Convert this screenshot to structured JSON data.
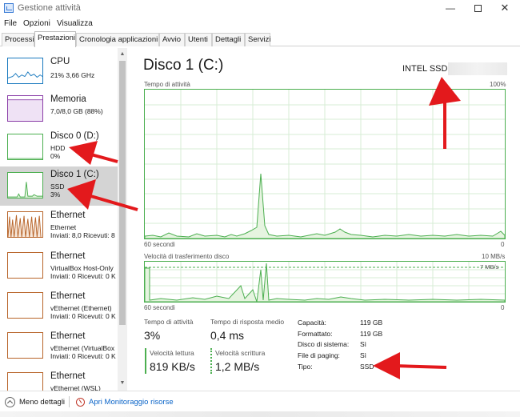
{
  "window": {
    "title": "Gestione attività",
    "controls": {
      "minimize": "—",
      "close": "✕"
    }
  },
  "menu": [
    "File",
    "Opzioni",
    "Visualizza"
  ],
  "tabs": [
    "Processi",
    "Prestazioni",
    "Cronologia applicazioni",
    "Avvio",
    "Utenti",
    "Dettagli",
    "Servizi"
  ],
  "active_tab": "Prestazioni",
  "sidebar": {
    "items": [
      {
        "title": "CPU",
        "sub1": "21% 3,66 GHz",
        "sub2": "",
        "color": "#1a7abf",
        "fill": "#ddeefa"
      },
      {
        "title": "Memoria",
        "sub1": "7,0/8,0 GB (88%)",
        "sub2": "",
        "color": "#8b3fa8",
        "fill": "#efe2f5"
      },
      {
        "title": "Disco 0 (D:)",
        "sub1": "HDD",
        "sub2": "0%",
        "color": "#4caf50",
        "fill": "#e6f4e0"
      },
      {
        "title": "Disco 1 (C:)",
        "sub1": "SSD",
        "sub2": "3%",
        "color": "#4caf50",
        "fill": "#e6f4e0"
      },
      {
        "title": "Ethernet",
        "sub1": "Ethernet",
        "sub2": "Inviati: 8,0  Ricevuti: 8",
        "color": "#b8652a",
        "fill": "#f7e6d8"
      },
      {
        "title": "Ethernet",
        "sub1": "VirtualBox Host-Only",
        "sub2": "Inviati: 0  Ricevuti: 0 K",
        "color": "#b8652a",
        "fill": "#fff"
      },
      {
        "title": "Ethernet",
        "sub1": "vEthernet (Ethernet)",
        "sub2": "Inviati: 0  Ricevuti: 0 K",
        "color": "#b8652a",
        "fill": "#fff"
      },
      {
        "title": "Ethernet",
        "sub1": "vEthernet (VirtualBox",
        "sub2": "Inviati: 0  Ricevuti: 0 K",
        "color": "#b8652a",
        "fill": "#fff"
      },
      {
        "title": "Ethernet",
        "sub1": "vEthernet (WSL)",
        "sub2": "",
        "color": "#b8652a",
        "fill": "#fff"
      }
    ],
    "selected_index": 3
  },
  "main": {
    "title": "Disco 1 (C:)",
    "model": "INTEL SSD",
    "graph1": {
      "label": "Tempo di attività",
      "max": "100%",
      "time": "60 secondi",
      "min": "0"
    },
    "graph2": {
      "label": "Velocità di trasferimento disco",
      "max": "10 MB/s",
      "secondary_max": "7 MB/s",
      "time": "60 secondi",
      "min": "0"
    },
    "stats": {
      "active_time_label": "Tempo di attività",
      "active_time_value": "3%",
      "response_label": "Tempo di risposta medio",
      "response_value": "0,4 ms",
      "read_label": "Velocità lettura",
      "read_value": "819 KB/s",
      "write_label": "Velocità scrittura",
      "write_value": "1,2 MB/s"
    },
    "info": [
      {
        "key": "Capacità:",
        "value": "119 GB"
      },
      {
        "key": "Formattato:",
        "value": "119 GB"
      },
      {
        "key": "Disco di sistema:",
        "value": "Sì"
      },
      {
        "key": "File di paging:",
        "value": "Sì"
      },
      {
        "key": "Tipo:",
        "value": "SSD"
      }
    ]
  },
  "footer": {
    "less_details": "Meno dettagli",
    "resource_monitor": "Apri Monitoraggio risorse"
  },
  "colors": {
    "disk_green": "#4caf50",
    "annotation_red": "#e3191c",
    "link_blue": "#0a64c8"
  }
}
